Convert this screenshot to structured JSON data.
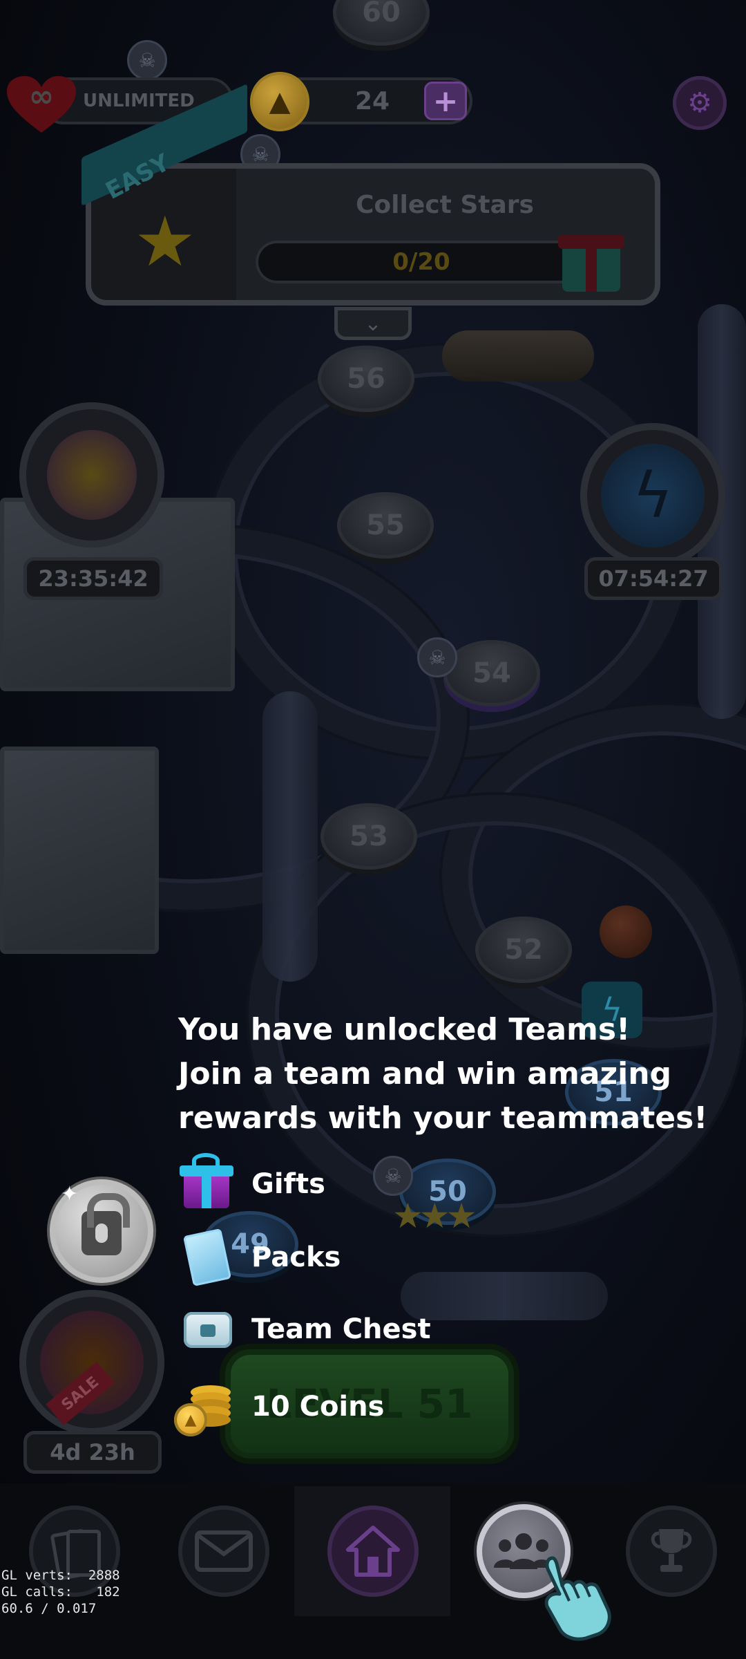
{
  "hud": {
    "lives_label": "UNLIMITED",
    "coins": "24"
  },
  "event_panel": {
    "difficulty": "EASY",
    "title": "Collect Stars",
    "progress_text": "0/20",
    "progress": 0
  },
  "timers": {
    "left_top": "23:35:42",
    "right_top": "07:54:27",
    "sale": "4d 23h"
  },
  "map_levels": [
    "60",
    "56",
    "55",
    "54",
    "53",
    "52",
    "50",
    "49",
    "51"
  ],
  "tutorial": {
    "lines": [
      "You have unlocked Teams!",
      "Join a team and win amazing",
      "rewards with your teammates!"
    ],
    "rewards": [
      "Gifts",
      "Packs",
      "Team Chest",
      "10 Coins"
    ]
  },
  "level_button": "LEVEL 51",
  "sale_tag": "SALE",
  "debug": {
    "line1": "GL verts:  2888",
    "line2": "GL calls:   182",
    "line3": "60.6 / 0.017"
  },
  "colors": {
    "accent_purple": "#6a3f8c",
    "level_green": "#1f4a20",
    "blue_node": "#1f3a5a"
  }
}
